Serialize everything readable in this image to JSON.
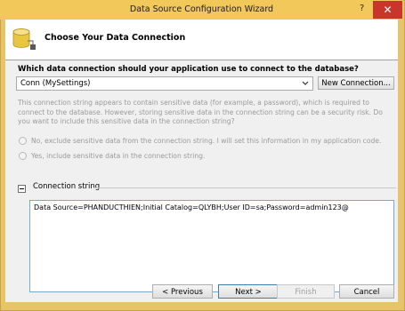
{
  "window": {
    "title": "Data Source Configuration Wizard",
    "help_label": "?",
    "close_label": "✕"
  },
  "header": {
    "title": "Choose Your Data Connection",
    "icon": "database-icon"
  },
  "question": "Which data connection should your application use to connect to the database?",
  "connection_combo": {
    "value": "Conn (MySettings)"
  },
  "new_connection_label": "New Connection...",
  "sensitive_text": "This connection string appears to contain sensitive data (for example, a password), which is required to connect to the database. However, storing sensitive data in the connection string can be a security risk. Do you want to include this sensitive data in the connection string?",
  "radio_no": "No, exclude sensitive data from the connection string. I will set this information in my application code.",
  "radio_yes": "Yes, include sensitive data in the connection string.",
  "conn_string_group_label": "Connection string",
  "conn_string_value": "Data Source=PHANDUCTHIEN;Initial Catalog=QLYBH;User ID=sa;Password=admin123@",
  "buttons": {
    "previous": "< Previous",
    "next": "Next >",
    "finish": "Finish",
    "cancel": "Cancel"
  },
  "colors": {
    "title_bar": "#f2c85b",
    "close_button": "#c7352c",
    "focus_border": "#3c7fb1"
  }
}
